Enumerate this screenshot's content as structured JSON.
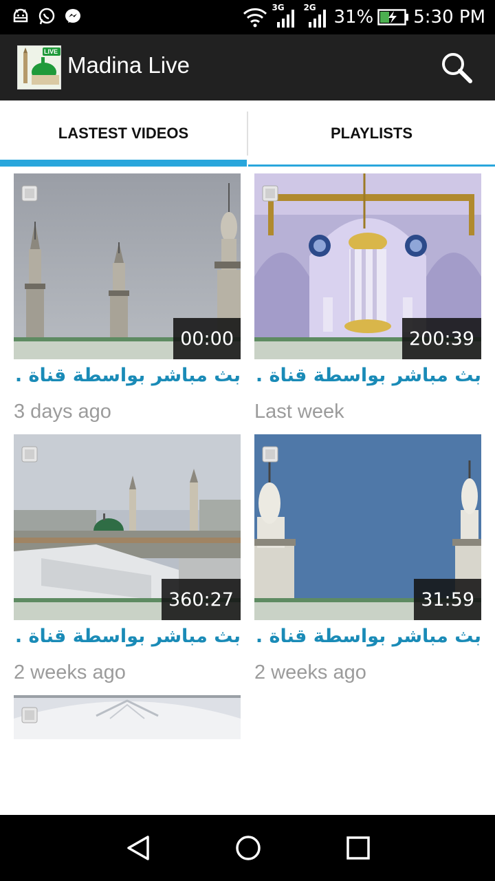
{
  "status_bar": {
    "icons_left": [
      "android-debug-icon",
      "whatsapp-icon",
      "messenger-icon"
    ],
    "net_3g": "3G",
    "net_2g": "2G",
    "battery_percent": "31%",
    "time": "5:30 PM"
  },
  "app_bar": {
    "title": "Madina Live",
    "logo_badge": "LIVE"
  },
  "tabs": [
    {
      "label": "LASTEST VIDEOS",
      "selected": true
    },
    {
      "label": "PLAYLISTS",
      "selected": false
    }
  ],
  "videos": [
    {
      "title": "بث مباشر بواسطة قناة ...",
      "duration": "00:00",
      "date": "3 days ago"
    },
    {
      "title": "بث مباشر بواسطة قناة ...",
      "duration": "200:39",
      "date": "Last week"
    },
    {
      "title": "بث مباشر بواسطة قناة ...",
      "duration": "360:27",
      "date": "2 weeks ago"
    },
    {
      "title": "بث مباشر بواسطة قناة ...",
      "duration": "31:59",
      "date": "2 weeks ago"
    }
  ],
  "colors": {
    "accent": "#29a6dc",
    "title_text": "#1a8bb7",
    "app_bar": "#212121"
  }
}
